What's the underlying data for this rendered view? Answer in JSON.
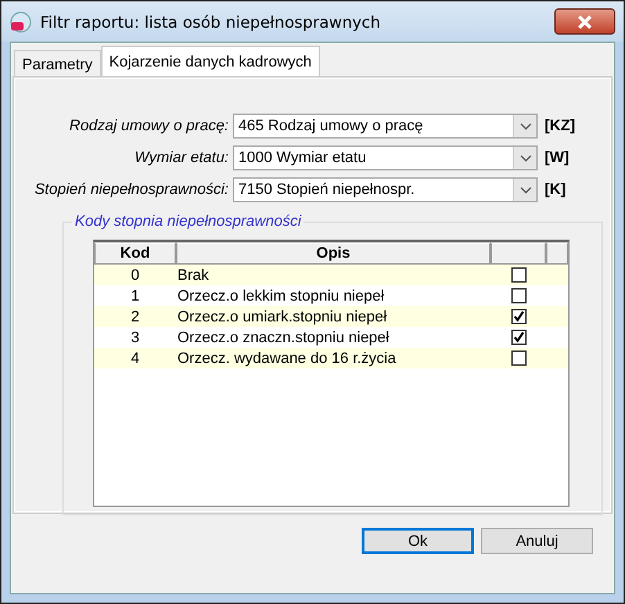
{
  "window": {
    "title": "Filtr raportu: lista osób niepełnosprawnych"
  },
  "tabs": [
    {
      "label": "Parametry",
      "selected": false
    },
    {
      "label": "Kojarzenie danych kadrowych",
      "selected": true
    }
  ],
  "fields": [
    {
      "label": "Rodzaj umowy o pracę:",
      "value": "465 Rodzaj umowy o pracę",
      "tag": "[KZ]"
    },
    {
      "label": "Wymiar etatu:",
      "value": "1000 Wymiar etatu",
      "tag": "[W]"
    },
    {
      "label": "Stopień niepełnosprawności:",
      "value": "7150 Stopień niepełnospr.",
      "tag": "[K]"
    }
  ],
  "group": {
    "title": "Kody stopnia niepełnosprawności",
    "table": {
      "columns": [
        "Kod",
        "Opis"
      ],
      "rows": [
        {
          "kod": "0",
          "opis": "Brak",
          "checked": false
        },
        {
          "kod": "1",
          "opis": "Orzecz.o lekkim stopniu niepeł",
          "checked": false
        },
        {
          "kod": "2",
          "opis": "Orzecz.o umiark.stopniu niepeł",
          "checked": true
        },
        {
          "kod": "3",
          "opis": "Orzecz.o znaczn.stopniu niepeł",
          "checked": true
        },
        {
          "kod": "4",
          "opis": "Orzecz. wydawane do 16 r.życia",
          "checked": false
        }
      ]
    }
  },
  "buttons": [
    {
      "label": "Ok",
      "kind": "default"
    },
    {
      "label": "Anuluj",
      "kind": "normal"
    }
  ]
}
